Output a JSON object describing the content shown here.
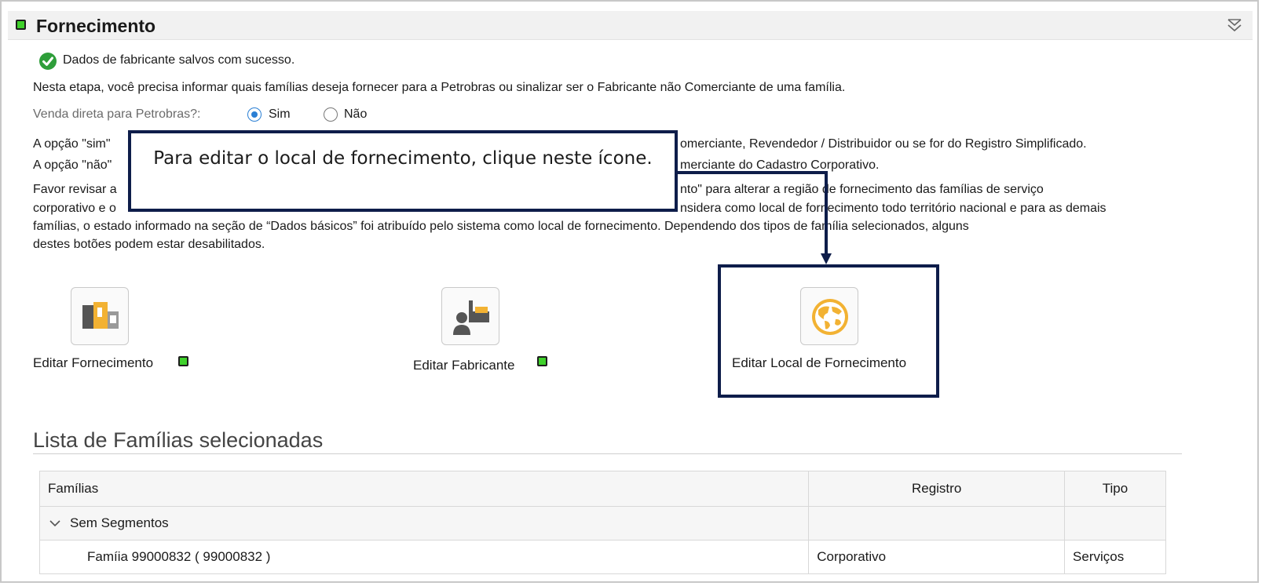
{
  "panel": {
    "title": "Fornecimento",
    "collapse_icon": "double-chevron-down-icon"
  },
  "messages": {
    "success": "Dados de fabricante salvos com sucesso.",
    "intro": "Nesta etapa, você precisa informar quais famílias deseja fornecer para a Petrobras ou sinalizar ser o Fabricante não Comerciante de uma família."
  },
  "direct_sale": {
    "label": "Venda direta para Petrobras?:",
    "options": [
      "Sim",
      "Não"
    ],
    "selected": "Sim"
  },
  "info_lines": {
    "sim_start": "A opção \"sim\"",
    "sim_end": "omerciante, Revendedor / Distribuidor ou se for do Registro Simplificado.",
    "nao_start": "A opção \"não\"",
    "nao_end": "merciante do Cadastro Corporativo.",
    "favor_start": "Favor revisar a",
    "favor_end": "nto\" para alterar a região de fornecimento das famílias de serviço",
    "corp_start": "corporativo e o",
    "corp_end": "nsidera como local de fornecimento todo território nacional e para as demais",
    "familias": "famílias, o estado informado na seção de “Dados básicos” foi atribuído pelo sistema como local de fornecimento. Dependendo dos tipos de família selecionados, alguns",
    "destes": "destes botões podem estar desabilitados."
  },
  "callout": {
    "text": "Para editar o local de fornecimento, clique neste ícone."
  },
  "actions": [
    {
      "label": "Editar Fornecimento",
      "icon": "supply-edit-icon",
      "status": "green"
    },
    {
      "label": "Editar Fabricante",
      "icon": "manufacturer-edit-icon",
      "status": "green"
    },
    {
      "label": "Editar Local de Fornecimento",
      "icon": "globe-icon"
    }
  ],
  "families": {
    "title": "Lista de Famílias selecionadas",
    "columns": [
      "Famílias",
      "Registro",
      "Tipo"
    ],
    "group": "Sem Segmentos",
    "rows": [
      {
        "name": "Famíia 99000832 ( 99000832 )",
        "registro": "Corporativo",
        "tipo": "Serviços"
      }
    ]
  },
  "colors": {
    "status_green": "#3fd12b",
    "callout_border": "#0e1d4a",
    "radio_selected": "#2a7fd4",
    "success_icon": "#2e9e3a",
    "icon_accent": "#f2b233"
  }
}
